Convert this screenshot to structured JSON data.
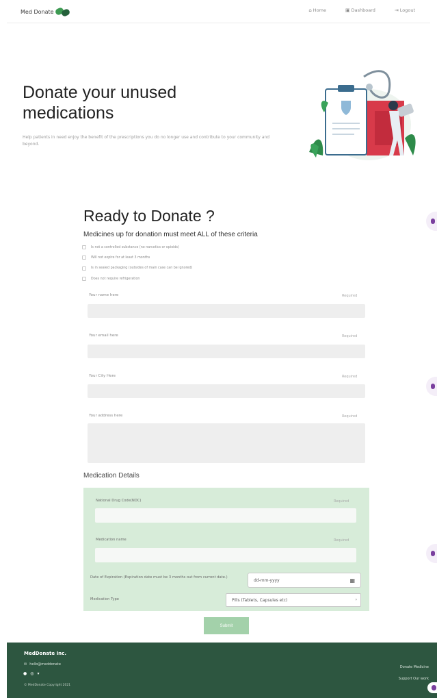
{
  "nav": {
    "brand": "Med Donate",
    "links": [
      {
        "icon": "home-icon",
        "glyph": "⌂",
        "label": "Home"
      },
      {
        "icon": "dashboard-icon",
        "glyph": "▣",
        "label": "Dashboard"
      },
      {
        "icon": "logout-icon",
        "glyph": "⇥",
        "label": "Logout"
      }
    ]
  },
  "hero": {
    "title": "Donate your unused medications",
    "subtitle": "Help patients in need enjoy the benefit of the prescriptions you do no longer use and contribute to your community and beyond."
  },
  "form": {
    "title": "Ready to Donate ?",
    "criteria_title": "Medicines up for donation must meet ALL of these criteria",
    "criteria": [
      "Is not a controlled substance (no narcotics or opioids)",
      "Will not expire for at least 3 months",
      "Is in sealed packaging (outsides of main case can be ignored)",
      "Does not require refrigeration"
    ],
    "fields": [
      {
        "label": "Your name here",
        "req": "Required"
      },
      {
        "label": "Your email here",
        "req": "Required"
      },
      {
        "label": "Your City Here",
        "req": "Required"
      },
      {
        "label": "Your address here",
        "req": "Required"
      }
    ],
    "medication": {
      "title": "Medication Details",
      "ndc_label": "National Drug Code(NDC)",
      "ndc_req": "Required",
      "name_label": "Medication name",
      "name_req": "Required",
      "expiry_label": "Date of Expiration (Expiration date must be 3 months out from current date.)",
      "date_placeholder": "dd-mm-yyyy",
      "type_label": "Medication Type",
      "type_value": "Pills (Tablets, Capsules etc)"
    },
    "submit": "Submit"
  },
  "footer": {
    "brand": "MedDonate Inc.",
    "email": "hello@meddonate",
    "social_icons": [
      "facebook-icon",
      "instagram-icon",
      "twitter-icon"
    ],
    "copyright": "© MedDonate Copyright 2021",
    "links": [
      "Donate Medicine",
      "Support Our work"
    ]
  },
  "colors": {
    "brand_green": "#2d5640",
    "accent_green": "#a3d1aa",
    "panel_green": "#d7ecd9",
    "side_tab_purple": "#7a3f9e"
  }
}
